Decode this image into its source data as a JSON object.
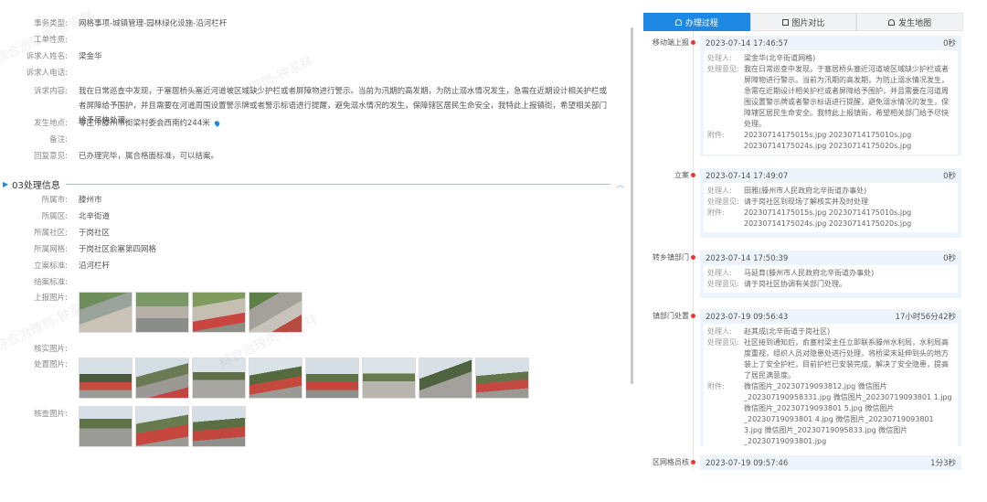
{
  "left": {
    "fields": [
      {
        "label": "事务类型:",
        "value": "网格事项-城镇管理-园林绿化设施-沿河栏杆"
      },
      {
        "label": "工单性质:",
        "value": ""
      },
      {
        "label": "诉求人姓名:",
        "value": "梁金华"
      },
      {
        "label": "诉求人电话:",
        "value": ""
      },
      {
        "label": "诉求内容:",
        "value": "我在日常巡查中发现，于塞居桥头塞近河道坡区域缺少护栏或者屏障物进行警示。当前为汛期的高发期，为防止溺水情况发生，急需在近期设计相关护栏或者屏障给予围护，并且需要在河道周围设置警示牌或者警示标语进行提醒，避免溺水情况的发生，保障辖区居民生命安全，我特此上报镇街，希望相关部门给予尽快处理。"
      },
      {
        "label": "发生地点:",
        "value": "零庄市滕州市街梁村委会西南约244米"
      },
      {
        "label": "备注:",
        "value": ""
      },
      {
        "label": "回复意见:",
        "value": "已办理完毕，属合格面标准，可以结案。"
      }
    ],
    "section_title": "03处理信息",
    "info": [
      {
        "label": "所属市:",
        "value": "滕州市"
      },
      {
        "label": "所属区:",
        "value": "北辛街道"
      },
      {
        "label": "所属社区:",
        "value": "于岗社区"
      },
      {
        "label": "所属网格:",
        "value": "于岗社区俞塞第四网格"
      },
      {
        "label": "立案标准:",
        "value": "沿河栏杆"
      },
      {
        "label": "结案标准:",
        "value": ""
      },
      {
        "label": "上报图片:",
        "value": ""
      },
      {
        "label": "核实图片:",
        "value": ""
      },
      {
        "label": "处置图片:",
        "value": ""
      },
      {
        "label": "核查图片:",
        "value": ""
      }
    ],
    "watermark": "综合治理岗-钟家祥"
  },
  "right": {
    "tabs": [
      {
        "label": "办理过程",
        "active": true
      },
      {
        "label": "图片对比",
        "active": false
      },
      {
        "label": "发生地图",
        "active": false
      }
    ],
    "steps": [
      {
        "name": "移动端上报",
        "time": "2023-07-14 17:46:57",
        "duration": "0秒",
        "handler": "梁金华(北辛街道网格)",
        "opinion": "我在日常巡查中发现，于塞居桥头塞近河道坡区域缺少护栏或者屏障物进行警示。当前为汛期的高发期，为防止溺水情况发生，急需在近期设计相关护栏或者屏障给予围护，并且需要在河道周围设置警示牌或者警示标语进行提醒，避免溺水情况的发生，保障辖区居民生命安全。我特此上报镇街，希望相关部门给予尽快处理。",
        "attachments": "20230714175015s.jpg 20230714175010s.jpg 20230714175024s.jpg 20230714175020s.jpg"
      },
      {
        "name": "立案",
        "time": "2023-07-14 17:49:07",
        "duration": "0秒",
        "handler": "田雅(滕州市人民政府北辛街道办事处)",
        "opinion": "请于岗社区到现场了解核实并及时处理",
        "attachments": "20230714175015s.jpg 20230714175010s.jpg 20230714175024s.jpg 20230714175020s.jpg"
      },
      {
        "name": "转乡镇部门",
        "time": "2023-07-14 17:50:39",
        "duration": "0秒",
        "handler": "马延育(滕州市人民政府北辛街道办事处)",
        "opinion": "请于岗社区协调有关部门处理。",
        "attachments": ""
      },
      {
        "name": "镇部门处置",
        "time": "2023-07-19 09:56:43",
        "duration": "17小时56分42秒",
        "handler": "赵其成(北辛街道于岗社区)",
        "opinion": "社区接到通知后，俞塞村梁主任立即联系滕州水利局，水利局高度重视，组织人员对隐患处进行处理，将桥梁末延伸到头的地方装上了安全护栏，目前护栏已安装完成，解决了安全隐患，提高了居民满意度。",
        "attachments": "微信图片_20230719093812.jpg 微信图片_202307190958331.jpg 微信图片_20230719093801 1.jpg 微信图片_20230719093801 5.jpg 微信图片_20230719093801 4.jpg 微信图片_20230719093801 3.jpg 微信图片_20230719095833.jpg 微信图片_20230719093801.jpg"
      },
      {
        "name": "区网格员核",
        "time": "2023-07-19 09:57:46",
        "duration": "1分3秒",
        "handler": "",
        "opinion": "",
        "attachments": ""
      }
    ],
    "labels": {
      "handler": "处理人:",
      "opinion": "处理意见:",
      "attachments": "附件:"
    }
  }
}
